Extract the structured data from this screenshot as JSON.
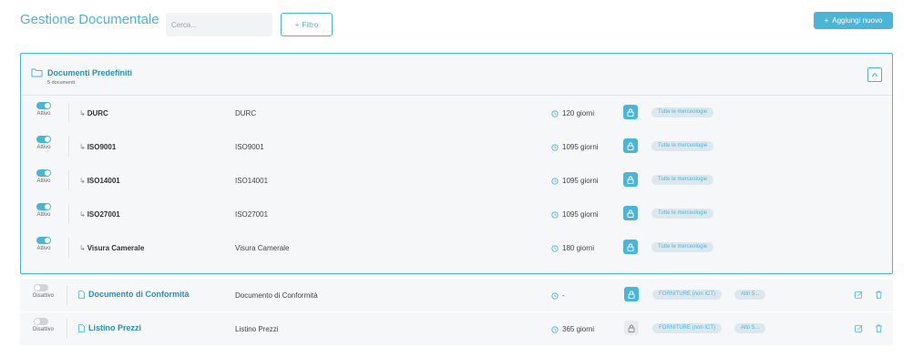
{
  "header": {
    "title": "Gestione Documentale",
    "search_placeholder": "Cerca...",
    "filter_label": "Filtro",
    "add_label": "Aggiungi nuovo",
    "accent_color": "#4ab5d6"
  },
  "group": {
    "title": "Documenti Predefiniti",
    "subtitle": "5 documenti",
    "rows": [
      {
        "status": "Attivo",
        "name": "DURC",
        "description": "DURC",
        "days": "120 giorni",
        "tag": "Tutte le merceologie"
      },
      {
        "status": "Attivo",
        "name": "ISO9001",
        "description": "ISO9001",
        "days": "1095 giorni",
        "tag": "Tutte le merceologie"
      },
      {
        "status": "Attivo",
        "name": "ISO14001",
        "description": "ISO14001",
        "days": "1095 giorni",
        "tag": "Tutte le merceologie"
      },
      {
        "status": "Attivo",
        "name": "ISO27001",
        "description": "ISO27001",
        "days": "1095 giorni",
        "tag": "Tutte le merceologie"
      },
      {
        "status": "Attivo",
        "name": "Visura Camerale",
        "description": "Visura Camerale",
        "days": "180 giorni",
        "tag": "Tutte le merceologie"
      }
    ]
  },
  "documents": [
    {
      "status": "Disattivo",
      "name": "Documento di Conformità",
      "description": "Documento di Conformità",
      "days": "-",
      "tag1": "FORNITURE (non ICT)",
      "tag2": "Altri 5..."
    },
    {
      "status": "Disattivo",
      "name": "Listino Prezzi",
      "description": "Listino Prezzi",
      "days": "365 giorni",
      "tag1": "FORNITURE (non ICT)",
      "tag2": "Altri 5..."
    }
  ]
}
